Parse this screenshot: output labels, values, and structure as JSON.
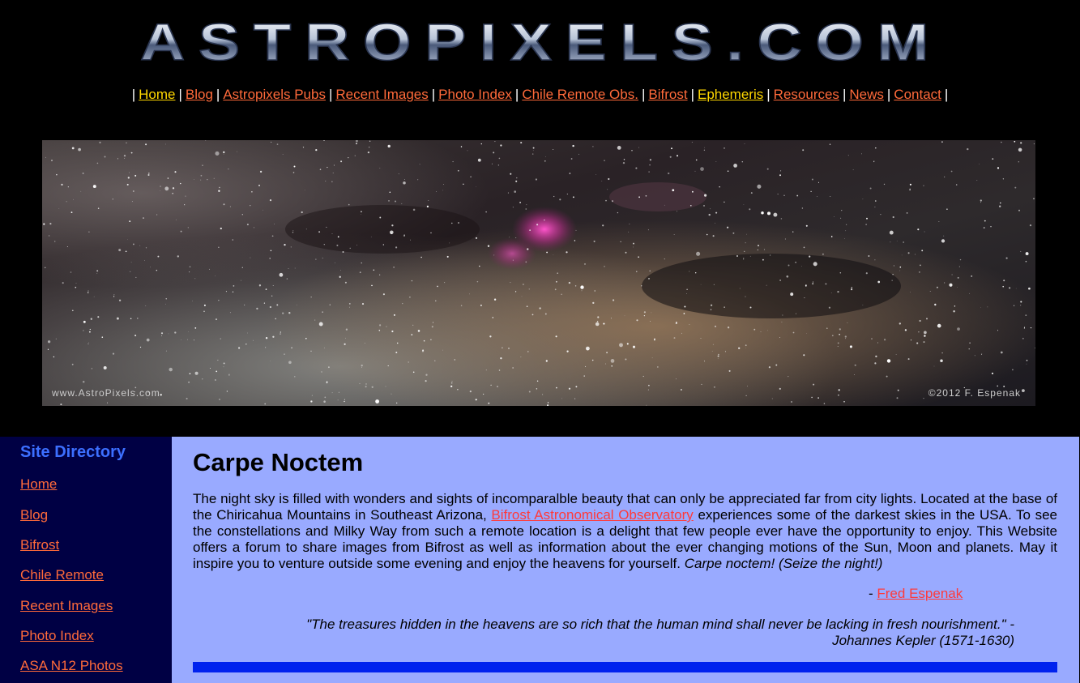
{
  "header": {
    "logo_text": "AstroPixels.com"
  },
  "nav": {
    "items": [
      {
        "label": "Home",
        "color": "#ffd700"
      },
      {
        "label": "Blog",
        "color": "#ff6a3a"
      },
      {
        "label": "Astropixels Pubs",
        "color": "#ff6a3a"
      },
      {
        "label": "Recent Images",
        "color": "#ff6a3a"
      },
      {
        "label": "Photo Index",
        "color": "#ff6a3a"
      },
      {
        "label": "Chile Remote Obs.",
        "color": "#ff6a3a"
      },
      {
        "label": "Bifrost",
        "color": "#ff6a3a"
      },
      {
        "label": "Ephemeris",
        "color": "#ffd700"
      },
      {
        "label": "Resources",
        "color": "#ff6a3a"
      },
      {
        "label": "News",
        "color": "#ff6a3a"
      },
      {
        "label": "Contact",
        "color": "#ff6a3a"
      }
    ],
    "separator": "|"
  },
  "banner": {
    "watermark_left": "www.AstroPixels.com",
    "watermark_right": "©2012 F. Espenak"
  },
  "sidebar": {
    "title": "Site Directory",
    "items": [
      "Home",
      "Blog",
      "Bifrost",
      "Chile Remote",
      "Recent Images",
      "Photo Index",
      "ASA N12 Photos"
    ]
  },
  "main": {
    "title": "Carpe Noctem",
    "intro_before": "The night sky is filled with wonders and sights of incomparalble beauty that can only be appreciated far from city lights. Located at the base of the Chiricahua Mountains in Southeast Arizona, ",
    "intro_link": "Bifrost Astronomical Observatory",
    "intro_after": " experiences some of the darkest skies in the USA. To see the constellations and Milky Way from such a remote location is a delight that few people ever have the opportunity to enjoy. This Website offers a forum to share images from Bifrost as well as information about the ever changing motions of the Sun, Moon and planets. May it inspire you to venture outside some evening and enjoy the heavens for yourself. ",
    "intro_italic": "Carpe noctem! (Seize the night!)",
    "signature_prefix": "- ",
    "signature_link": "Fred Espenak",
    "quote_line1": "\"The treasures hidden in the heavens are so rich that the human mind shall never be lacking in fresh nourishment.\" -",
    "quote_line2": "Johannes Kepler (1571-1630)"
  }
}
